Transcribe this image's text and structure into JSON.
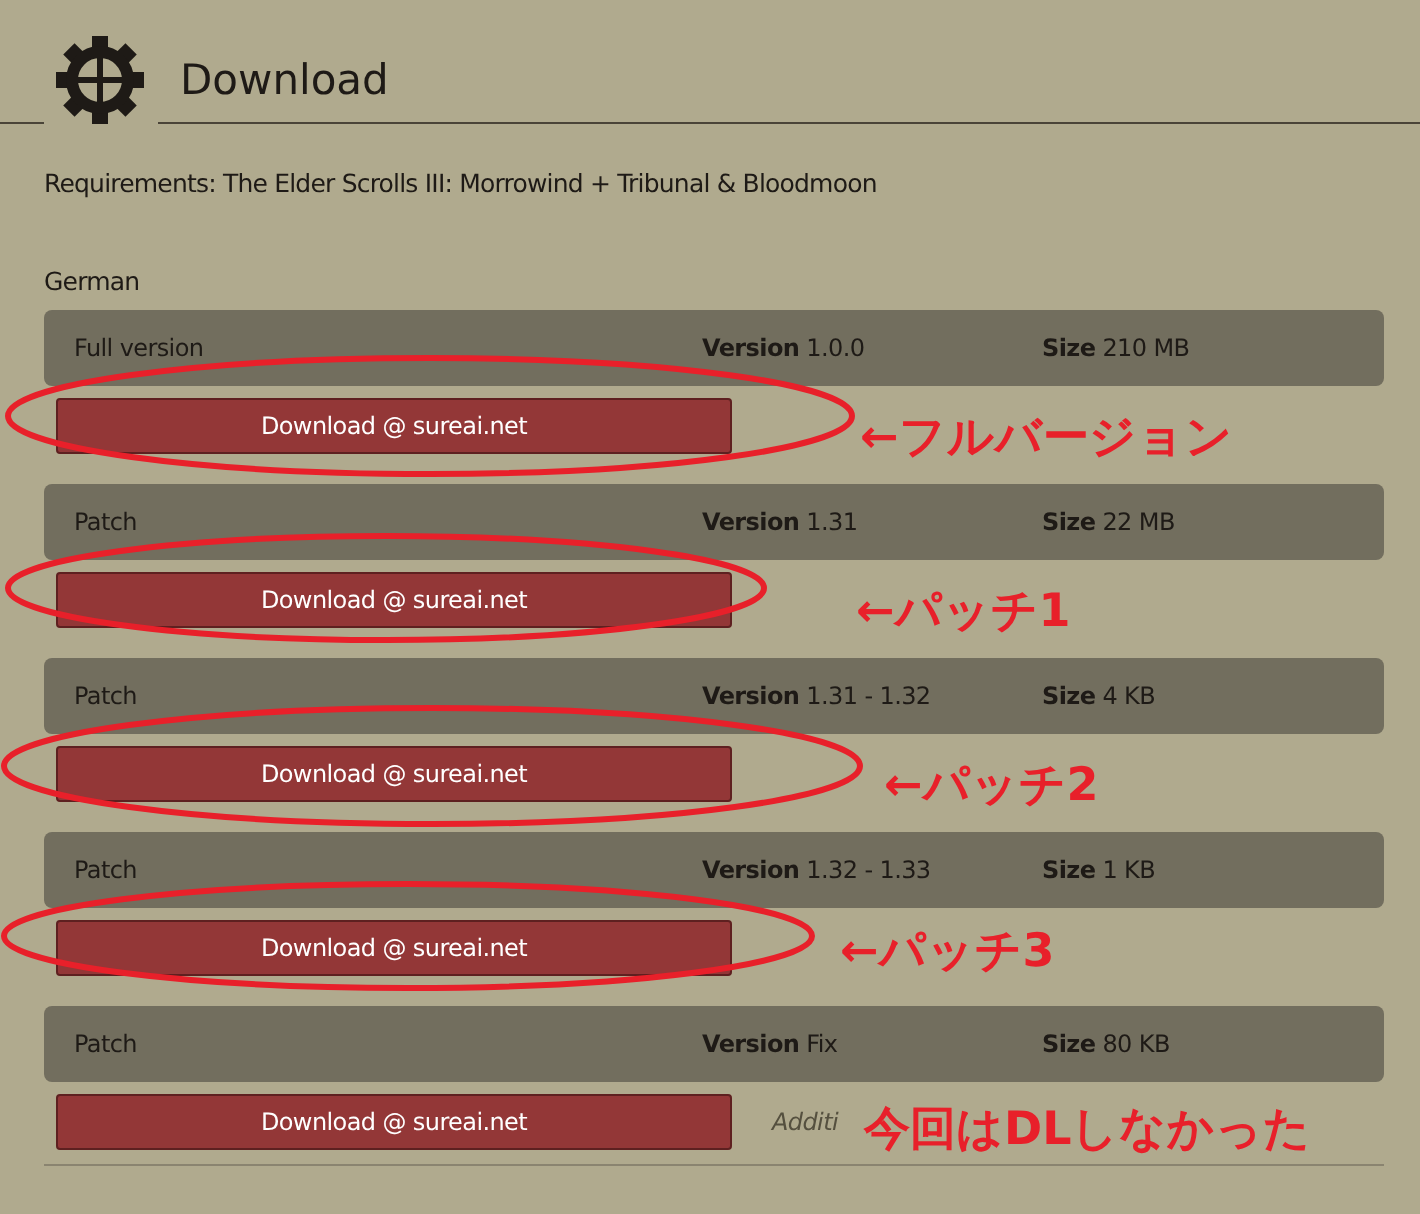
{
  "header": {
    "title": "Download"
  },
  "requirements": "Requirements: The Elder Scrolls III: Morrowind + Tribunal & Bloodmoon",
  "language": "German",
  "downloads": [
    {
      "label": "Full version",
      "version_label": "Version",
      "version": "1.0.0",
      "size_label": "Size",
      "size": "210 MB",
      "button": "Download @ sureai.net",
      "circled": true,
      "annotation": "←フルバージョン"
    },
    {
      "label": "Patch",
      "version_label": "Version",
      "version": "1.31",
      "size_label": "Size",
      "size": "22 MB",
      "button": "Download @ sureai.net",
      "circled": true,
      "annotation": "←パッチ1"
    },
    {
      "label": "Patch",
      "version_label": "Version",
      "version": "1.31 - 1.32",
      "size_label": "Size",
      "size": "4 KB",
      "button": "Download @ sureai.net",
      "circled": true,
      "annotation": "←パッチ2"
    },
    {
      "label": "Patch",
      "version_label": "Version",
      "version": "1.32 - 1.33",
      "size_label": "Size",
      "size": "1 KB",
      "button": "Download @ sureai.net",
      "circled": true,
      "annotation": "←パッチ3"
    },
    {
      "label": "Patch",
      "version_label": "Version",
      "version": "Fix",
      "size_label": "Size",
      "size": "80 KB",
      "button": "Download @ sureai.net",
      "note": "Additi",
      "circled": false,
      "annotation": "今回はDLしなかった"
    }
  ]
}
